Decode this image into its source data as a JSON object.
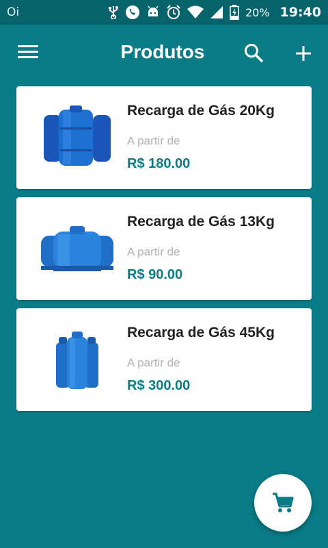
{
  "status_bar": {
    "carrier": "Oi",
    "battery": "20%",
    "time": "19:40",
    "icons": [
      "usb-icon",
      "whatsapp-icon",
      "android-icon",
      "alarm-icon",
      "wifi-icon",
      "signal-icon",
      "battery-icon"
    ]
  },
  "toolbar": {
    "title": "Produtos",
    "menu_icon": "menu-icon",
    "search_icon": "search-icon",
    "add_icon": "add-icon"
  },
  "products": [
    {
      "name": "Recarga de Gás 20Kg",
      "from_label": "A partir de",
      "price": "R$ 180.00",
      "image": "gas-cylinders-20kg"
    },
    {
      "name": "Recarga de Gás 13Kg",
      "from_label": "A partir de",
      "price": "R$ 90.00",
      "image": "gas-cylinders-13kg"
    },
    {
      "name": "Recarga de Gás 45Kg",
      "from_label": "A partir de",
      "price": "R$ 300.00",
      "image": "gas-cylinders-45kg"
    }
  ],
  "fab": {
    "icon": "cart-icon"
  },
  "colors": {
    "primary": "#0a7c87",
    "status_bar": "#06636c",
    "card": "#ffffff",
    "price": "#0a7c87",
    "cylinder_blue": "#1d6fd1"
  }
}
